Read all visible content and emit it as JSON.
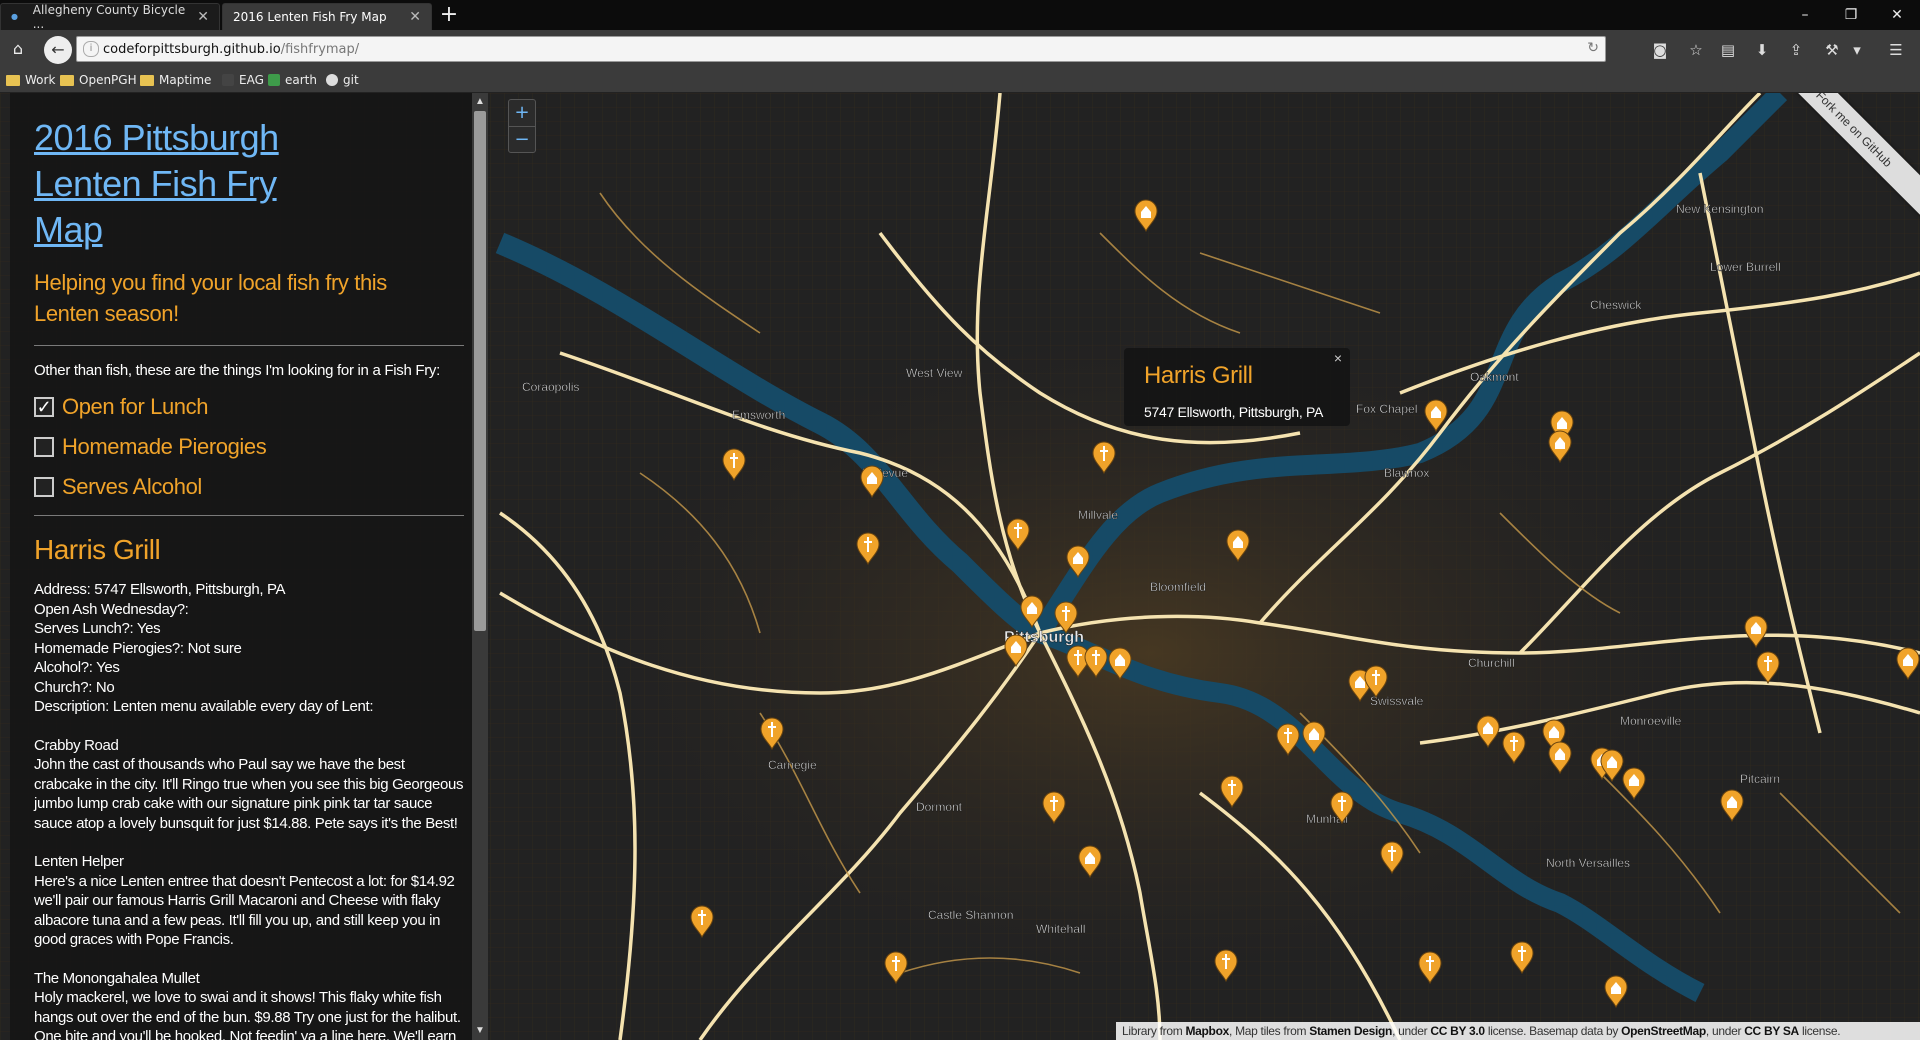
{
  "browser": {
    "tabs": [
      {
        "title": "Allegheny County Bicycle ...",
        "active": false
      },
      {
        "title": "2016 Lenten Fish Fry Map",
        "active": true
      }
    ],
    "new_tab": "+",
    "url_host": "codeforpittsburgh.github.io",
    "url_path": "/fishfrymap/",
    "bookmarks": [
      {
        "label": "Work",
        "type": "folder"
      },
      {
        "label": "OpenPGH",
        "type": "folder"
      },
      {
        "label": "Maptime",
        "type": "folder"
      },
      {
        "label": "EAG",
        "type": "link"
      },
      {
        "label": "earth",
        "type": "link"
      },
      {
        "label": "git",
        "type": "link"
      }
    ]
  },
  "sidebar": {
    "title_line1": "2016 Pittsburgh",
    "title_line2": "Lenten Fish Fry Map",
    "subtitle": "Helping you find your local fish fry this Lenten season!",
    "intro": "Other than fish, these are the things I'm looking for in a Fish Fry:",
    "filters": [
      {
        "label": "Open for Lunch",
        "checked": true
      },
      {
        "label": "Homemade Pierogies",
        "checked": false
      },
      {
        "label": "Serves Alcohol",
        "checked": false
      }
    ],
    "place": {
      "name": "Harris Grill",
      "address": "Address: 5747 Ellsworth, Pittsburgh, PA",
      "ash_wednesday": "Open Ash Wednesday?:",
      "lunch": "Serves Lunch?: Yes",
      "pierogies": "Homemade Pierogies?: Not sure",
      "alcohol": "Alcohol?: Yes",
      "church": "Church?: No",
      "description": "Description: Lenten menu available every day of Lent:",
      "menu": [
        {
          "name": "Crabby Road",
          "desc": "John the cast of thousands who Paul say we have the best crabcake in the city. It'll Ringo true when you see this big Georgeous jumbo lump crab cake with our signature pink pink tar tar sauce sauce atop a lovely bunsquit for just $14.88. Pete says it's the Best!"
        },
        {
          "name": "Lenten Helper",
          "desc": "Here's a nice Lenten entree that doesn't Pentecost a lot: for $14.92 we'll pair our famous Harris Grill Macaroni and Cheese with flaky albacore tuna and a few peas. It'll fill you up, and still keep you in good graces with Pope Francis."
        },
        {
          "name": "The Monongahalea Mullet",
          "desc": "Holy mackerel, we love to swai and it shows! This flaky white fish hangs out over the end of the bun. $9.88 Try one just for the halibut. One bite and you'll be hooked. Not feedin' ya a line here. We'll earn your boat of confidence. Thank cod this sandwich is back, 'cuz it"
        }
      ]
    }
  },
  "map": {
    "zoom_in": "+",
    "zoom_out": "−",
    "popup": {
      "title": "Harris Grill",
      "address": "5747 Ellsworth, Pittsburgh, PA",
      "close": "×"
    },
    "ribbon": "Fork me on GitHub",
    "labels": [
      {
        "text": "New Kensington"
      },
      {
        "text": "Lower Burrell"
      },
      {
        "text": "Cheswick"
      },
      {
        "text": "Oakmont"
      },
      {
        "text": "Fox Chapel"
      },
      {
        "text": "West View"
      },
      {
        "text": "Coraopolis"
      },
      {
        "text": "Emsworth"
      },
      {
        "text": "Bellevue"
      },
      {
        "text": "Millvale"
      },
      {
        "text": "Bloomfield"
      },
      {
        "text": "Blawnox"
      },
      {
        "text": "Pittsburgh"
      },
      {
        "text": "Churchill"
      },
      {
        "text": "Monroeville"
      },
      {
        "text": "Pitcairn"
      },
      {
        "text": "North Versailles"
      },
      {
        "text": "Dormont"
      },
      {
        "text": "Munhall"
      },
      {
        "text": "Castle Shannon"
      },
      {
        "text": "Whitehall"
      },
      {
        "text": "Carnegie"
      },
      {
        "text": "Swissvale"
      }
    ],
    "attribution": {
      "p1": "Library from ",
      "mapbox": "Mapbox",
      "p2": ", Map tiles from ",
      "stamen": "Stamen Design",
      "p3": ", under ",
      "cc1": "CC BY 3.0",
      "p4": " license. Basemap data by ",
      "osm": "OpenStreetMap",
      "p5": ", under ",
      "cc2": "CC BY SA",
      "p6": " license."
    }
  },
  "colors": {
    "marker": "#f0a32a",
    "title_link": "#6fb7f5",
    "river": "#164a66",
    "road": "#f5e3b0"
  }
}
